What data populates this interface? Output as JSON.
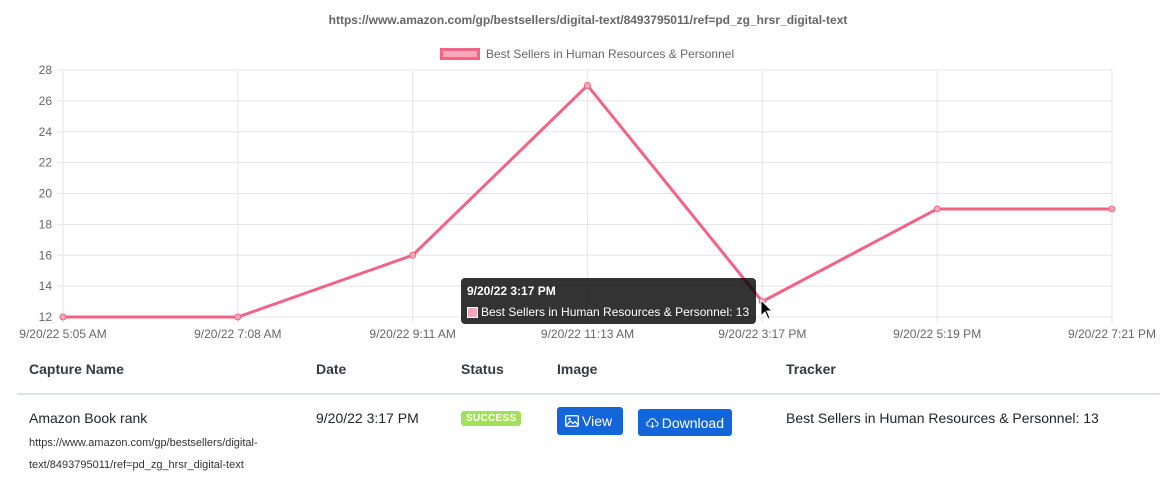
{
  "chart_title": "https://www.amazon.com/gp/bestsellers/digital-text/8493795011/ref=pd_zg_hrsr_digital-text",
  "chart_data": {
    "type": "line",
    "categories": [
      "9/20/22 5:05 AM",
      "9/20/22 7:08 AM",
      "9/20/22 9:11 AM",
      "9/20/22 11:13 AM",
      "9/20/22 3:17 PM",
      "9/20/22 5:19 PM",
      "9/20/22 7:21 PM"
    ],
    "series": [
      {
        "name": "Best Sellers in Human Resources & Personnel",
        "values": [
          12,
          12,
          16,
          27,
          13,
          19,
          19
        ],
        "color": "#f36385"
      }
    ],
    "ylim": [
      12,
      28
    ],
    "yticks": [
      "12",
      "14",
      "16",
      "18",
      "20",
      "22",
      "24",
      "26",
      "28"
    ],
    "grid": true,
    "legend": "top"
  },
  "tooltip": {
    "title": "9/20/22 3:17 PM",
    "label": "Best Sellers in Human Resources & Personnel: 13"
  },
  "table": {
    "headers": {
      "capture_name": "Capture Name",
      "date": "Date",
      "status": "Status",
      "image": "Image",
      "tracker": "Tracker"
    },
    "row": {
      "name": "Amazon Book rank",
      "url": "https://www.amazon.com/gp/bestsellers/digital-text/8493795011/ref=pd_zg_hrsr_digital-text",
      "date": "9/20/22 3:17 PM",
      "status": "SUCCESS",
      "view_label": "View",
      "download_label": "Download",
      "tracker": "Best Sellers in Human Resources & Personnel: 13"
    }
  },
  "colors": {
    "line": "#f36385",
    "fill": "#f7a8ba",
    "button": "#1266d9",
    "badge": "#a4e05a"
  },
  "icons": {
    "view": "image-icon",
    "download": "cloud-download-icon",
    "cursor": "mouse-pointer-icon"
  }
}
